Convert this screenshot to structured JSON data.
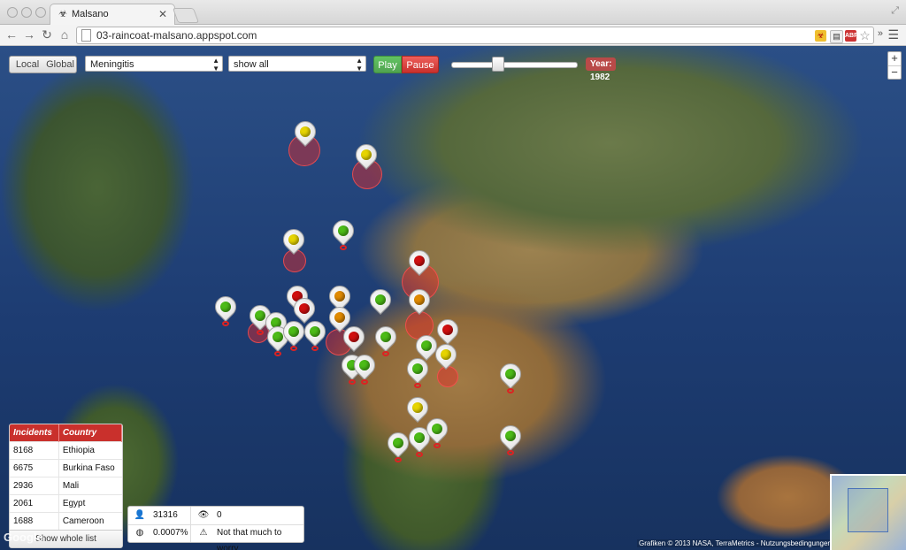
{
  "window": {
    "tab_title": "Malsano",
    "url": "03-raincoat-malsano.appspot.com"
  },
  "controls": {
    "local_label": "Local",
    "global_label": "Global",
    "disease_select": "Meningitis",
    "filter_select": "show all",
    "play_label": "Play",
    "pause_label": "Pause",
    "year_badge": "Year: 1982",
    "timeline_position": 0.36
  },
  "incidents_table": {
    "headers": [
      "Incidents",
      "Country"
    ],
    "rows": [
      [
        "8168",
        "Ethiopia"
      ],
      [
        "6675",
        "Burkina Faso"
      ],
      [
        "2936",
        "Mali"
      ],
      [
        "2061",
        "Egypt"
      ],
      [
        "1688",
        "Cameroon"
      ]
    ],
    "show_button": "Show whole list"
  },
  "stats": {
    "population": "31316",
    "watchers": "0",
    "percentage": "0.0007%",
    "warning": "Not that much to worry"
  },
  "map": {
    "attribution": "Grafiken © 2013 NASA, TerraMetrics - Nutzungsbedingungen",
    "logo": "Google",
    "zoom_in": "+",
    "zoom_out": "−"
  },
  "colors": {
    "green": "#4cbb17",
    "yellow": "#e6d400",
    "red": "#d01010",
    "orange": "#e08a00",
    "accent_red": "#c9302c"
  }
}
